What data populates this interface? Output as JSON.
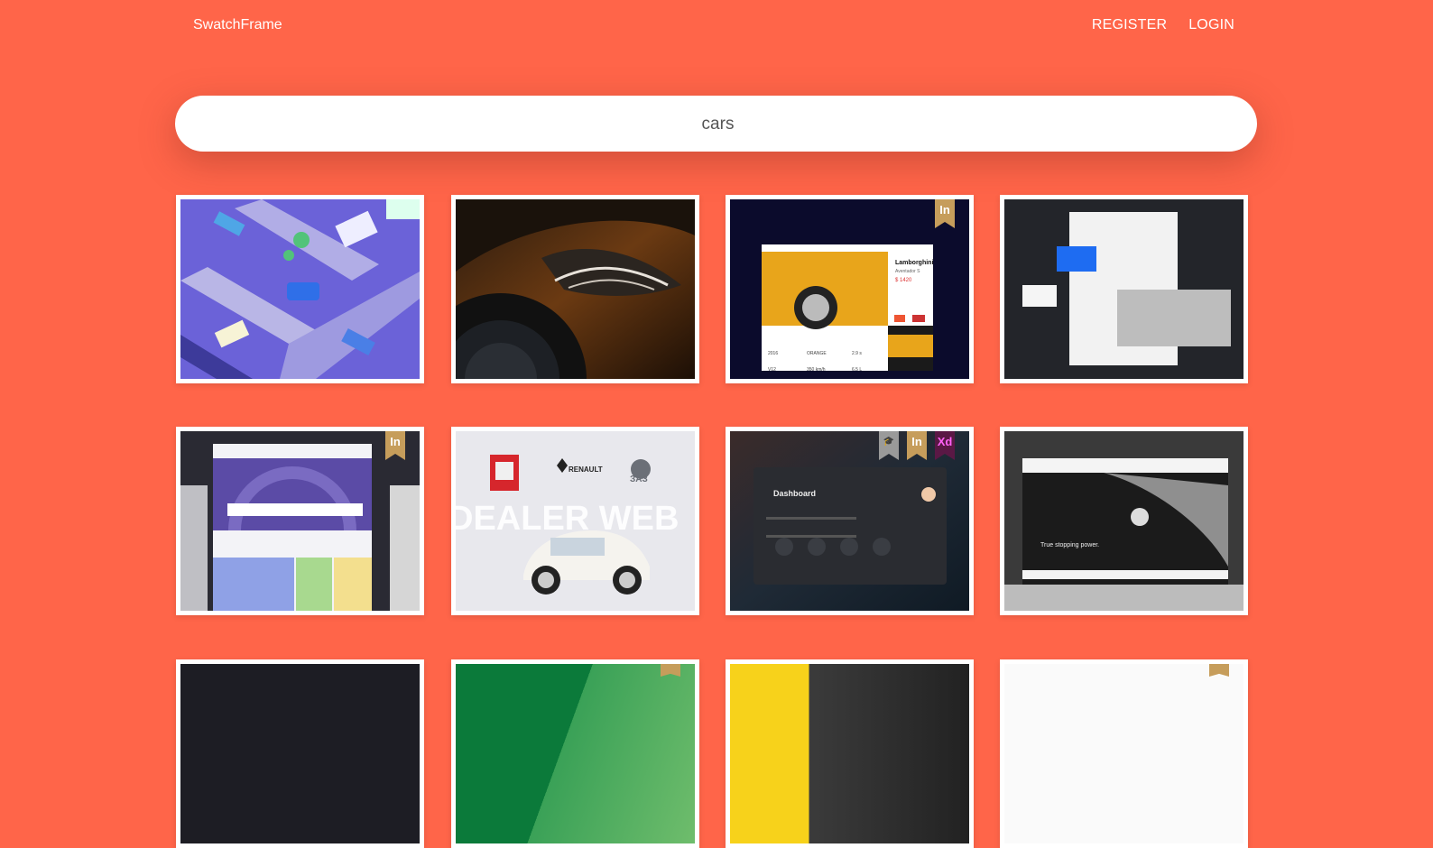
{
  "brand": "SwatchFrame",
  "nav": {
    "register": "REGISTER",
    "login": "LOGIN"
  },
  "search": {
    "value": "cars"
  },
  "colors": {
    "background": "#ff6549",
    "card": "#ffffff",
    "badge_in": "#c69d5b",
    "badge_xd": "#5a1845"
  },
  "cards": [
    {
      "kind": "isometric-city-illustration",
      "badges": []
    },
    {
      "kind": "car-headlight-photo",
      "badges": []
    },
    {
      "kind": "lamborghini-shop-ui",
      "badges": [
        "In"
      ],
      "text": {
        "title": "Lamborghini",
        "sub": "Aventador S",
        "price": "$ 1420",
        "stats": [
          "2016",
          "ORANGE",
          "2.9 s",
          "V12",
          "350 km/h",
          "6.5 L"
        ]
      }
    },
    {
      "kind": "stationery-mockup",
      "badges": []
    },
    {
      "kind": "tire-shop-website",
      "badges": [
        "In"
      ]
    },
    {
      "kind": "dealer-web-banner",
      "badges": [],
      "text": {
        "brand1": "RENAULT",
        "brand2": "ЗАЗ",
        "headline": "DEALER WEB"
      }
    },
    {
      "kind": "car-dashboard-ui",
      "badges": [
        "edu",
        "In",
        "Xd"
      ],
      "text": {
        "title": "Dashboard"
      }
    },
    {
      "kind": "luxury-car-site",
      "badges": [],
      "text": {
        "tagline": "True stopping power."
      }
    },
    {
      "kind": "dark-card",
      "badges": []
    },
    {
      "kind": "green-card",
      "badges": [
        "In"
      ]
    },
    {
      "kind": "yellow-card",
      "badges": []
    },
    {
      "kind": "white-card",
      "badges": [
        "In"
      ]
    }
  ]
}
